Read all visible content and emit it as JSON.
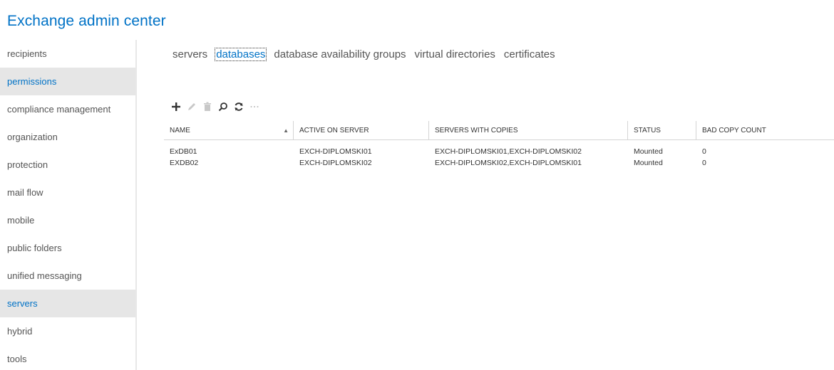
{
  "app": {
    "title": "Exchange admin center"
  },
  "sidebar": {
    "items": [
      {
        "label": "recipients"
      },
      {
        "label": "permissions"
      },
      {
        "label": "compliance management"
      },
      {
        "label": "organization"
      },
      {
        "label": "protection"
      },
      {
        "label": "mail flow"
      },
      {
        "label": "mobile"
      },
      {
        "label": "public folders"
      },
      {
        "label": "unified messaging"
      },
      {
        "label": "servers"
      },
      {
        "label": "hybrid"
      },
      {
        "label": "tools"
      }
    ],
    "selected": "servers",
    "hover": "permissions"
  },
  "tabs": [
    {
      "label": "servers"
    },
    {
      "label": "databases"
    },
    {
      "label": "database availability groups"
    },
    {
      "label": "virtual directories"
    },
    {
      "label": "certificates"
    }
  ],
  "active_tab": "databases",
  "toolbar": {
    "icons": [
      "add-icon",
      "edit-icon",
      "delete-icon",
      "search-icon",
      "refresh-icon",
      "more-icon"
    ]
  },
  "grid": {
    "columns": [
      "NAME",
      "ACTIVE ON SERVER",
      "SERVERS WITH COPIES",
      "STATUS",
      "BAD COPY COUNT"
    ],
    "sort_column": "NAME",
    "sort_direction": "ascending",
    "rows": [
      {
        "name": "ExDB01",
        "active": "EXCH-DIPLOMSKI01",
        "copies": "EXCH-DIPLOMSKI01,EXCH-DIPLOMSKI02",
        "status": "Mounted",
        "bad": "0"
      },
      {
        "name": "EXDB02",
        "active": "EXCH-DIPLOMSKI02",
        "copies": "EXCH-DIPLOMSKI02,EXCH-DIPLOMSKI01",
        "status": "Mounted",
        "bad": "0"
      }
    ]
  },
  "colors": {
    "accent": "#0072c6",
    "selected_bg": "#e6e6e6",
    "text": "#333333"
  }
}
